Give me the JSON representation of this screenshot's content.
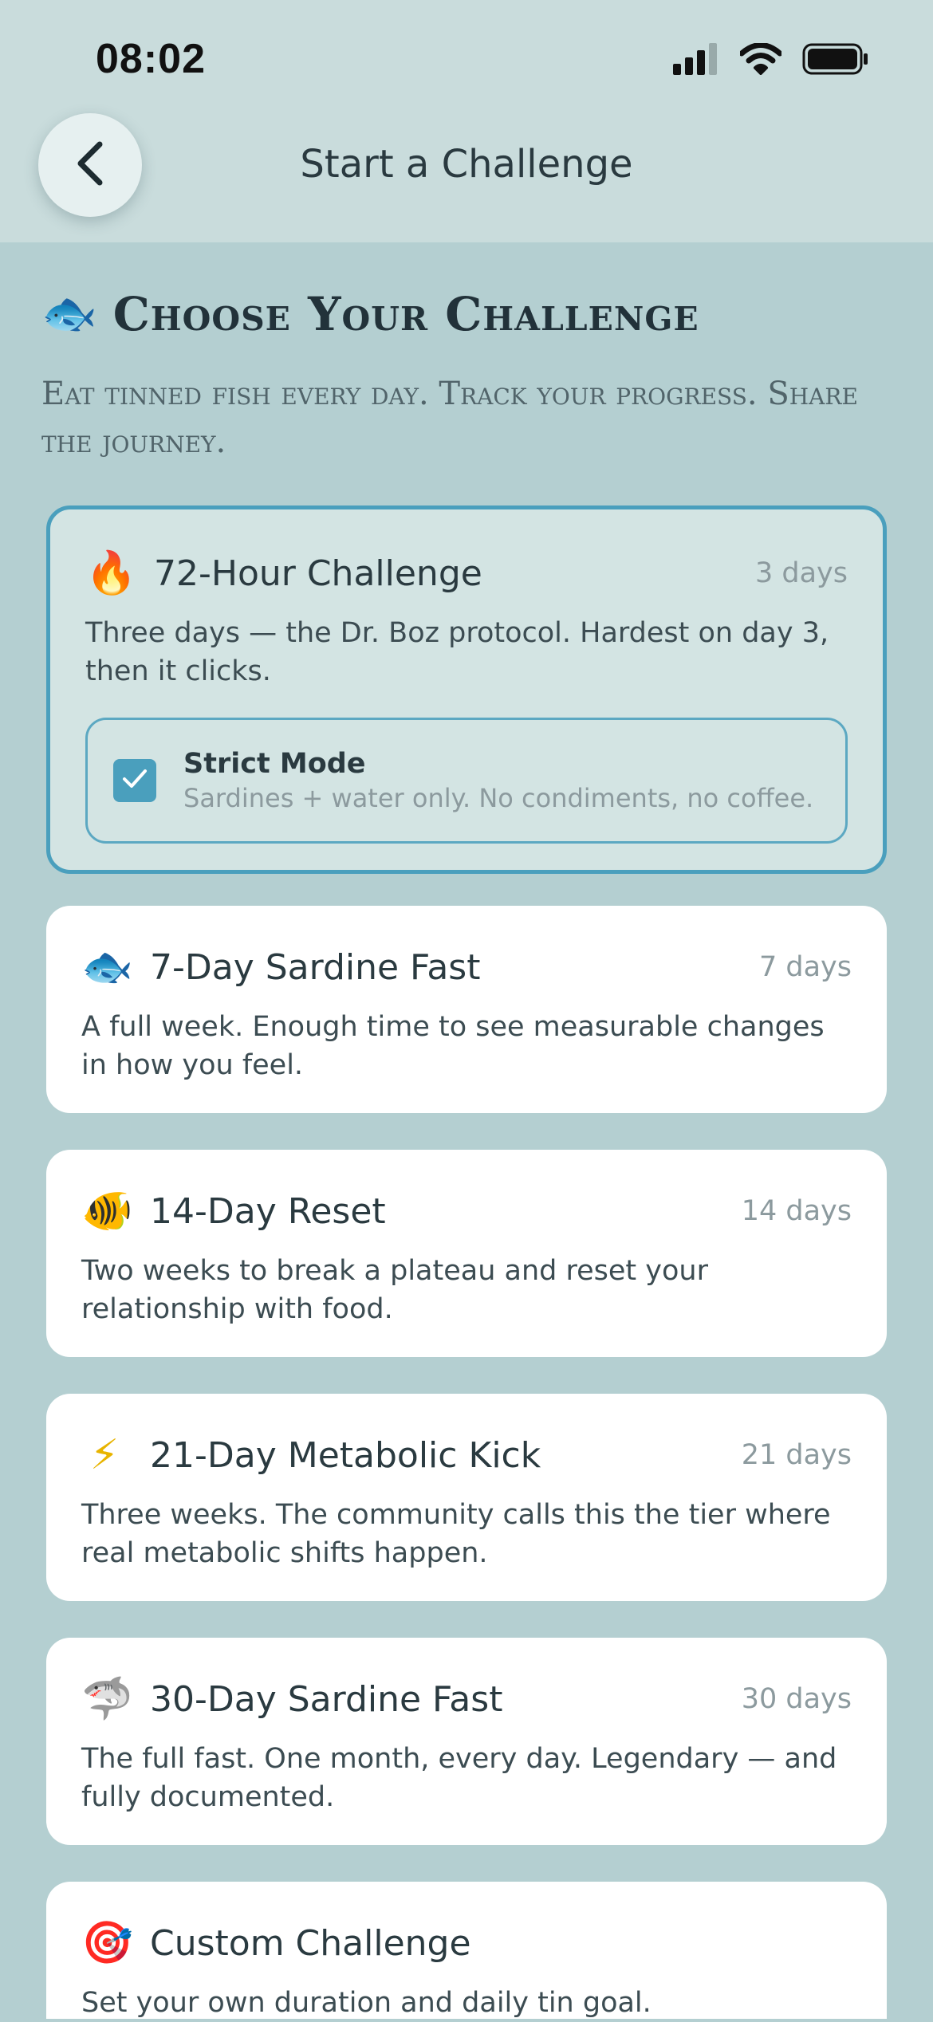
{
  "status_bar": {
    "time": "08:02"
  },
  "nav": {
    "title": "Start a Challenge"
  },
  "intro": {
    "emoji": "🐟",
    "heading": "Choose Your Challenge",
    "subheading": "Eat tinned fish every day. Track your progress. Share the journey."
  },
  "challenges": [
    {
      "emoji": "🔥",
      "title": "72-Hour Challenge",
      "days": "3 days",
      "description": "Three days — the Dr. Boz protocol. Hardest on day 3, then it clicks.",
      "selected": true,
      "strict_mode": {
        "label": "Strict Mode",
        "description": "Sardines + water only. No condiments, no coffee.",
        "checked": true
      }
    },
    {
      "emoji": "🐟",
      "title": "7-Day Sardine Fast",
      "days": "7 days",
      "description": "A full week. Enough time to see measurable changes in how you feel."
    },
    {
      "emoji": "🐠",
      "title": "14-Day Reset",
      "days": "14 days",
      "description": "Two weeks to break a plateau and reset your relationship with food."
    },
    {
      "emoji": "⚡",
      "title": "21-Day Metabolic Kick",
      "days": "21 days",
      "description": "Three weeks. The community calls this the tier where real metabolic shifts happen."
    },
    {
      "emoji": "🦈",
      "title": "30-Day Sardine Fast",
      "days": "30 days",
      "description": "The full fast. One month, every day. Legendary — and fully documented."
    },
    {
      "emoji": "🎯",
      "title": "Custom Challenge",
      "days": "",
      "description": "Set your own duration and daily tin goal."
    }
  ],
  "colors": {
    "background": "#b4cfd1",
    "accent": "#4a9fbd",
    "selected_card": "#d3e4e3"
  }
}
